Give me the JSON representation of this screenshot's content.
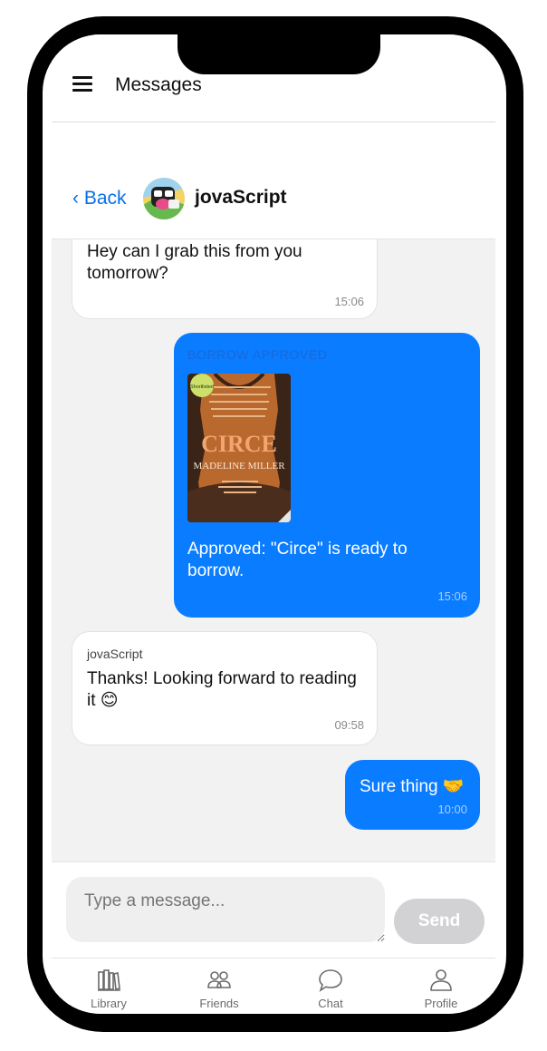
{
  "app": {
    "title": "Messages"
  },
  "chat": {
    "back_label": "‹ Back",
    "contact_name": "jovaScript"
  },
  "messages": [
    {
      "direction": "incoming",
      "text": "Hey can I grab this from you tomorrow?",
      "time": "15:06"
    },
    {
      "direction": "outgoing",
      "tag": "BORROW APPROVED",
      "book_cover": {
        "title": "CIRCE",
        "author": "MADELINE MILLER",
        "badge": "Shortlisted"
      },
      "text": "Approved: \"Circe\" is ready to borrow.",
      "time": "15:06"
    },
    {
      "direction": "incoming",
      "sender": "jovaScript",
      "text": "Thanks! Looking forward to reading it 😊",
      "time": "09:58"
    },
    {
      "direction": "outgoing",
      "text": "Sure thing 🤝",
      "time": "10:00"
    }
  ],
  "composer": {
    "placeholder": "Type a message...",
    "send_label": "Send"
  },
  "tabs": [
    {
      "label": "Library",
      "icon": "books-icon"
    },
    {
      "label": "Friends",
      "icon": "friends-icon"
    },
    {
      "label": "Chat",
      "icon": "chat-bubble-icon"
    },
    {
      "label": "Profile",
      "icon": "person-icon"
    }
  ],
  "colors": {
    "accent": "#0a7cff",
    "link": "#0a6fe6",
    "send_disabled": "#d2d2d4",
    "chat_background": "#f2f2f3"
  }
}
